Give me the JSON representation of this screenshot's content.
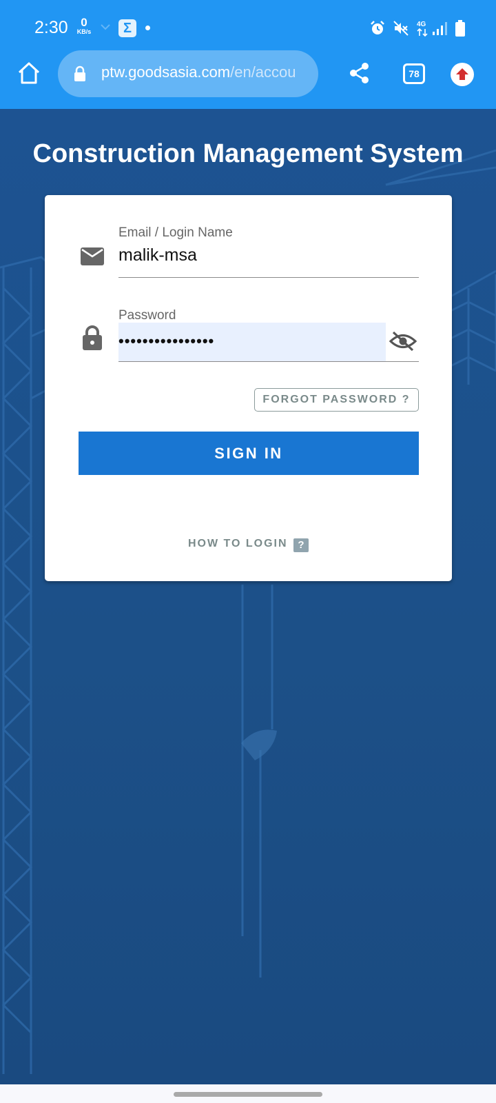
{
  "status_bar": {
    "time": "2:30",
    "net_speed_value": "0",
    "net_speed_unit": "KB/s",
    "icons": [
      "download-icon",
      "sigma-app-icon",
      "notification-dot-icon",
      "alarm-icon",
      "mute-icon",
      "network-4g-icon",
      "signal-icon",
      "battery-icon"
    ]
  },
  "browser": {
    "url_domain": "ptw.goodsasia.com",
    "url_path": "/en/accou",
    "tab_count": "78"
  },
  "page": {
    "title": "Construction Management System"
  },
  "login_form": {
    "email_label": "Email / Login Name",
    "email_value": "malik-msa",
    "password_label": "Password",
    "password_masked": "••••••••••••••••",
    "forgot_label": "FORGOT PASSWORD ?",
    "signin_label": "SIGN IN",
    "howto_label": "HOW TO LOGIN",
    "howto_icon": "?"
  },
  "colors": {
    "status_bar": "#2196f3",
    "background": "#1c4f88",
    "signin_button": "#1976d2",
    "password_fill": "#e8f0fe"
  }
}
